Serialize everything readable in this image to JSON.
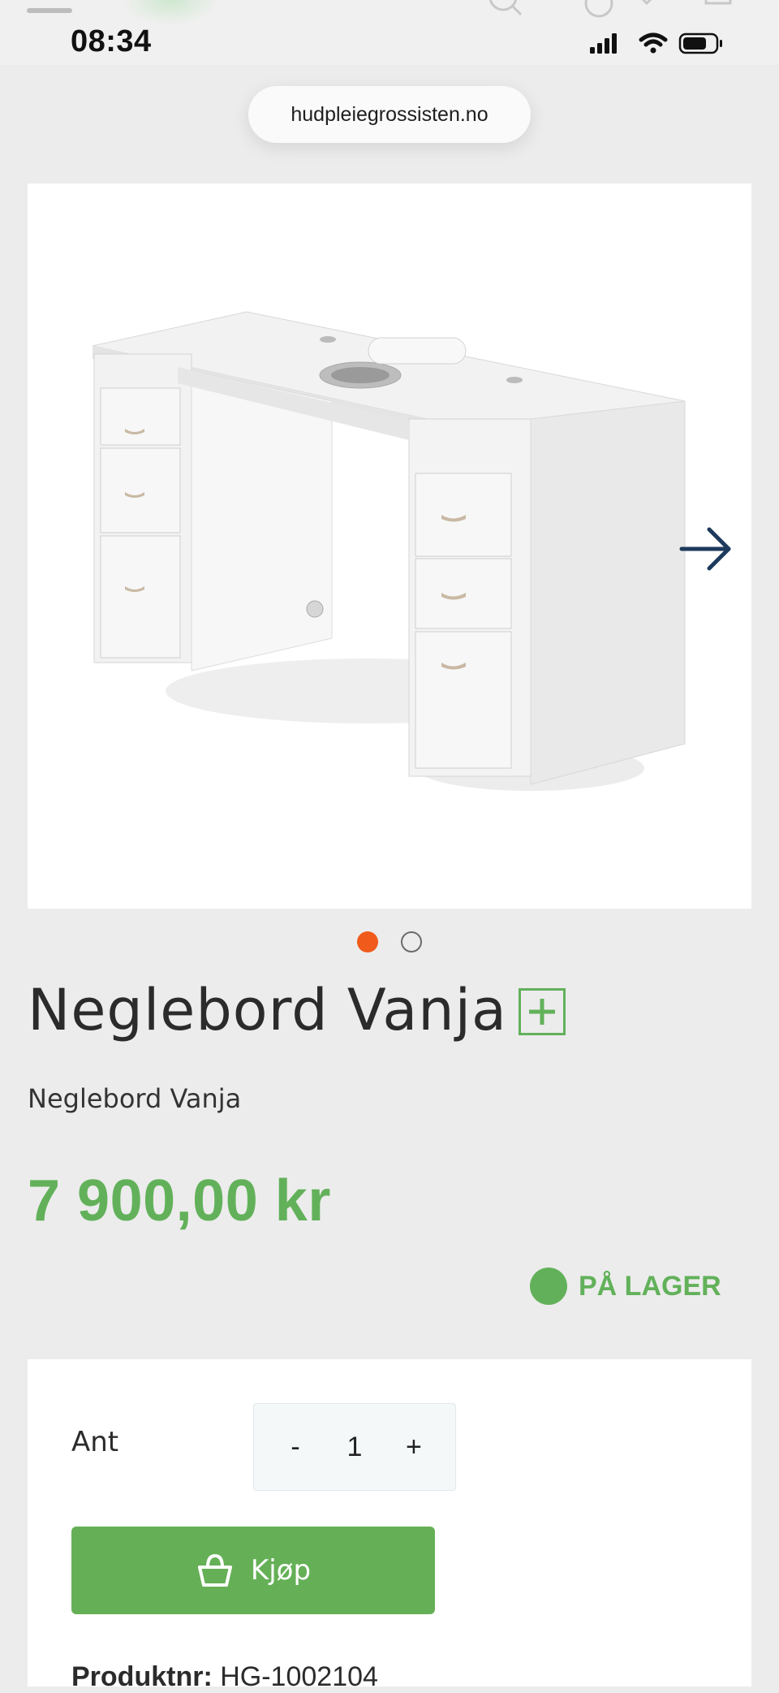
{
  "status_bar": {
    "time": "08:34"
  },
  "browser": {
    "url": "hudpleiegrossisten.no"
  },
  "gallery": {
    "image_alt": "Neglebord Vanja",
    "slide_count": 2,
    "active_slide": 1
  },
  "product": {
    "title": "Neglebord Vanja",
    "subtitle": "Neglebord Vanja",
    "price": "7 900,00 kr",
    "stock_status": "PÅ LAGER"
  },
  "purchase": {
    "qty_label": "Ant",
    "decrement": "-",
    "quantity": "1",
    "increment": "+",
    "buy_label": "Kjøp",
    "product_no_label": "Produktnr:",
    "product_no_value": "HG-1002104"
  },
  "icons": {
    "next": "arrow-right-icon",
    "expand": "plus-icon",
    "cart": "basket-icon",
    "signal": "cellular-signal-icon",
    "wifi": "wifi-icon",
    "battery": "battery-icon"
  },
  "colors": {
    "accent_green": "#62b15a",
    "active_dot": "#f05a1a",
    "arrow": "#1d3a5c"
  }
}
